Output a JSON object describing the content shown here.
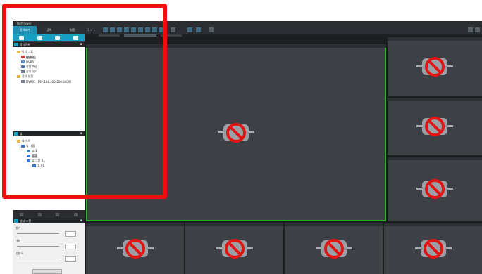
{
  "app": {
    "title": "NetViewer"
  },
  "sidebar": {
    "tabs": [
      "원격보기",
      "검색",
      "설정"
    ],
    "active_tab": 0,
    "device_panel": {
      "title": "장치목록",
      "items": [
        {
          "label": "장치 그룹",
          "icon": "folder-icon"
        },
        {
          "label": "NVR01",
          "icon": "dvr-icon",
          "selected": true
        },
        {
          "label": "DVR01",
          "icon": "dvr-icon"
        },
        {
          "label": "상황 화면",
          "icon": "monitor-icon"
        },
        {
          "label": "장치 찾기",
          "icon": "search-device-icon"
        },
        {
          "label": "장치 설정",
          "icon": "folder-icon"
        },
        {
          "label": "DVR01 (192.168.200.200:8000)",
          "icon": "camera-icon"
        }
      ]
    },
    "view_panel": {
      "title": "뷰",
      "items": [
        {
          "label": "뷰 목록",
          "icon": "folder-icon"
        },
        {
          "label": "뷰 그룹",
          "icon": "view-group-icon"
        },
        {
          "label": "뷰 1",
          "icon": "view-icon"
        },
        {
          "label": "뷰 2",
          "icon": "view-icon",
          "selected": true
        },
        {
          "label": "뷰 그룹 01",
          "icon": "view-group-icon"
        },
        {
          "label": "뷰 01",
          "icon": "view-icon"
        }
      ]
    },
    "ptz_panel": {
      "title": "영상 조정",
      "rows": [
        "밝기",
        "대비",
        "선명도"
      ]
    }
  },
  "toolbar": {
    "split_label": "1 × 1",
    "layout_label": "분할"
  },
  "subbar": {
    "tab_a": "카메라",
    "tab_b": "화면 1",
    "tab_c": "화면 2"
  },
  "colors": {
    "selected_tile": "#2bb52b",
    "highlight_frame": "#f50d0d",
    "accent": "#17a0c2"
  },
  "tiles": [
    {
      "id": "main",
      "state": "no-signal"
    },
    {
      "id": "r1",
      "state": "no-signal"
    },
    {
      "id": "r2",
      "state": "no-signal"
    },
    {
      "id": "r3",
      "state": "no-signal"
    },
    {
      "id": "b1",
      "state": "no-signal"
    },
    {
      "id": "b2",
      "state": "no-signal"
    },
    {
      "id": "b3",
      "state": "no-signal"
    },
    {
      "id": "b4",
      "state": "no-signal"
    }
  ]
}
